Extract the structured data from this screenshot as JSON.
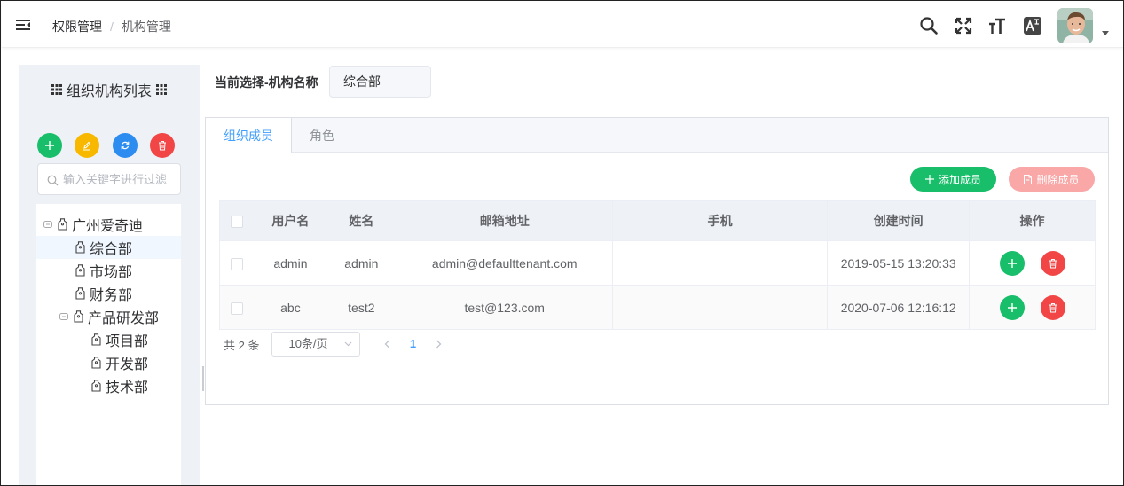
{
  "header": {
    "breadcrumb": [
      "权限管理",
      "机构管理"
    ],
    "breadcrumb_sep": "/",
    "icons": [
      "menu-toggle-icon",
      "search-icon",
      "fullscreen-icon",
      "font-size-icon",
      "translate-icon"
    ]
  },
  "left": {
    "title": "组织机构列表",
    "search_placeholder": "输入关键字进行过滤",
    "tree": [
      {
        "label": "广州爱奇迪",
        "level": 0,
        "expandable": true
      },
      {
        "label": "综合部",
        "level": 1,
        "expandable": false,
        "active": true
      },
      {
        "label": "市场部",
        "level": 1,
        "expandable": false
      },
      {
        "label": "财务部",
        "level": 1,
        "expandable": false
      },
      {
        "label": "产品研发部",
        "level": 1,
        "expandable": true
      },
      {
        "label": "项目部",
        "level": 2,
        "expandable": false
      },
      {
        "label": "开发部",
        "level": 2,
        "expandable": false
      },
      {
        "label": "技术部",
        "level": 2,
        "expandable": false
      }
    ]
  },
  "selection": {
    "label": "当前选择-机构名称",
    "value": "综合部"
  },
  "tabs": [
    {
      "label": "组织成员",
      "active": true
    },
    {
      "label": "角色",
      "active": false
    }
  ],
  "toolbar": {
    "add_label": "添加成员",
    "delete_label": "删除成员"
  },
  "table": {
    "columns": [
      "用户名",
      "姓名",
      "邮箱地址",
      "手机",
      "创建时间",
      "操作"
    ],
    "rows": [
      {
        "username": "admin",
        "name": "admin",
        "email": "admin@defaulttenant.com",
        "phone": "",
        "created": "2019-05-15 13:20:33"
      },
      {
        "username": "abc",
        "name": "test2",
        "email": "test@123.com",
        "phone": "",
        "created": "2020-07-06 12:16:12"
      }
    ]
  },
  "pager": {
    "total": "共 2 条",
    "page_size": "10条/页",
    "current_page": "1"
  },
  "colors": {
    "primary": "#409eff",
    "success": "#19be6b",
    "warning": "#f9b800",
    "info": "#2d8cf0",
    "danger": "#f24646",
    "danger_light": "#f9a7a7"
  }
}
